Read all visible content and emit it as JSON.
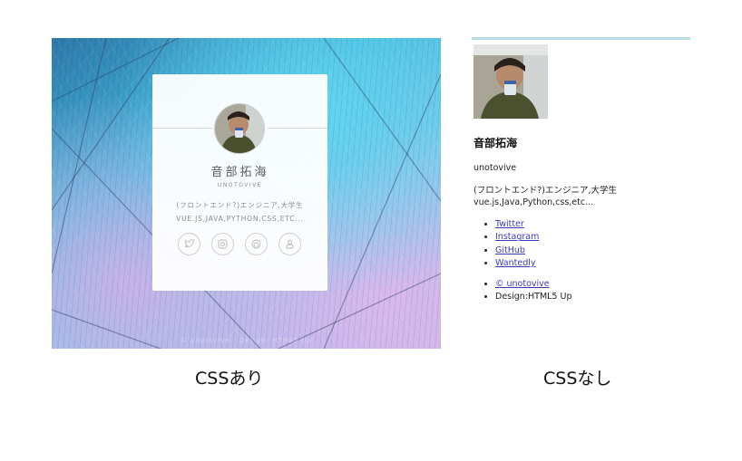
{
  "styled": {
    "name": "音部拓海",
    "username": "unotovive",
    "bio_line1": "(フロントエンド?)エンジニア,大学生",
    "bio_line2": "vue.js,Java,Python,css,etc...",
    "footer_faint": "© unotovive · Design: HTML5 Up",
    "icons": [
      "twitter-icon",
      "instagram-icon",
      "github-icon",
      "wantedly-icon"
    ]
  },
  "unstyled": {
    "name": "音部拓海",
    "username": "unotovive",
    "bio_line1": "(フロントエンド?)エンジニア,大学生",
    "bio_line2": "vue.js,Java,Python,css,etc...",
    "links": [
      "Twitter",
      "Instagram",
      "GitHub",
      "Wantedly"
    ],
    "copyright_link": "© unotovive",
    "design_credit": "Design:HTML5 Up"
  },
  "captions": {
    "left": "CSSあり",
    "right": "CSSなし"
  },
  "colors": {
    "link": "#3a3ab8",
    "topbar": "#b9dbe3",
    "card_bg": "#ffffff"
  }
}
